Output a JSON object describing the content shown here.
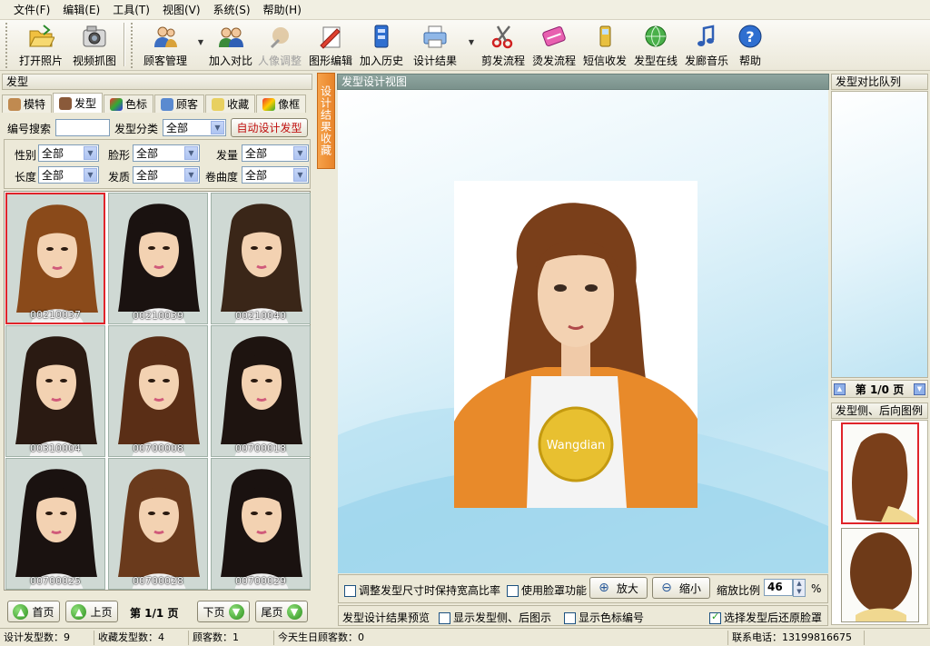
{
  "menu": [
    "文件(F)",
    "编辑(E)",
    "工具(T)",
    "视图(V)",
    "系统(S)",
    "帮助(H)"
  ],
  "toolbar": [
    {
      "label": "打开照片",
      "icon": "folder-open-icon"
    },
    {
      "label": "视频抓图",
      "icon": "camera-icon"
    },
    {
      "label": "顾客管理",
      "icon": "customers-icon",
      "dropdown": true
    },
    {
      "label": "加入对比",
      "icon": "compare-people-icon"
    },
    {
      "label": "人像调整",
      "icon": "portrait-adjust-icon",
      "disabled": true
    },
    {
      "label": "图形编辑",
      "icon": "graphic-edit-icon"
    },
    {
      "label": "加入历史",
      "icon": "history-icon"
    },
    {
      "label": "设计结果",
      "icon": "printer-icon",
      "dropdown": true
    },
    {
      "label": "剪发流程",
      "icon": "scissors-icon"
    },
    {
      "label": "烫发流程",
      "icon": "perm-icon"
    },
    {
      "label": "短信收发",
      "icon": "phone-icon"
    },
    {
      "label": "发型在线",
      "icon": "globe-icon"
    },
    {
      "label": "发廊音乐",
      "icon": "music-note-icon"
    },
    {
      "label": "帮助",
      "icon": "help-icon"
    }
  ],
  "left": {
    "title": "发型",
    "tabs": [
      {
        "label": "模特"
      },
      {
        "label": "发型",
        "active": true
      },
      {
        "label": "色标"
      },
      {
        "label": "顾客"
      },
      {
        "label": "收藏"
      },
      {
        "label": "像框"
      }
    ],
    "search_label": "编号搜索",
    "category_label": "发型分类",
    "category_value": "全部",
    "auto_button": "自动设计发型",
    "filters": {
      "gender_label": "性别",
      "gender": "全部",
      "face_label": "脸形",
      "face": "全部",
      "volume_label": "发量",
      "volume": "全部",
      "length_label": "长度",
      "length": "全部",
      "texture_label": "发质",
      "texture": "全部",
      "curl_label": "卷曲度",
      "curl": "全部"
    },
    "thumbnails": [
      "00210037",
      "00210039",
      "00210040",
      "00310004",
      "00700008",
      "00700018",
      "00700025",
      "00700028",
      "00700029"
    ],
    "pager": {
      "first": "首页",
      "prev": "上页",
      "page": "第 1/1 页",
      "next": "下页",
      "last": "尾页"
    }
  },
  "vertical_tab": "设计结果收藏",
  "center": {
    "title": "发型设计视图",
    "shirt_text": "Wangdian",
    "opt_keep_ratio": "调整发型尺寸时保持宽高比率",
    "opt_face_mask": "使用脸罩功能",
    "zoom_in": "放大",
    "zoom_out": "缩小",
    "zoom_label": "缩放比例",
    "zoom_value": "46",
    "zoom_unit": "%",
    "preview_label": "发型设计结果预览",
    "opt_show_side": "显示发型侧、后图示",
    "opt_show_color": "显示色标编号",
    "opt_restore_mask": "选择发型后还原脸罩"
  },
  "right": {
    "queue_title": "发型对比队列",
    "queue_pager": "第 1/0 页",
    "side_title": "发型侧、后向图例"
  },
  "status": {
    "designs": "设计发型数：9",
    "collected": "收藏发型数：4",
    "customers": "顾客数：1",
    "birthdays": "今天生日顾客数：0",
    "phone": "联系电话：13199816675"
  },
  "colors": {
    "accent_orange": "#e8842a",
    "select_red": "#e0242a",
    "hair_brown": "#7a3f1a"
  }
}
